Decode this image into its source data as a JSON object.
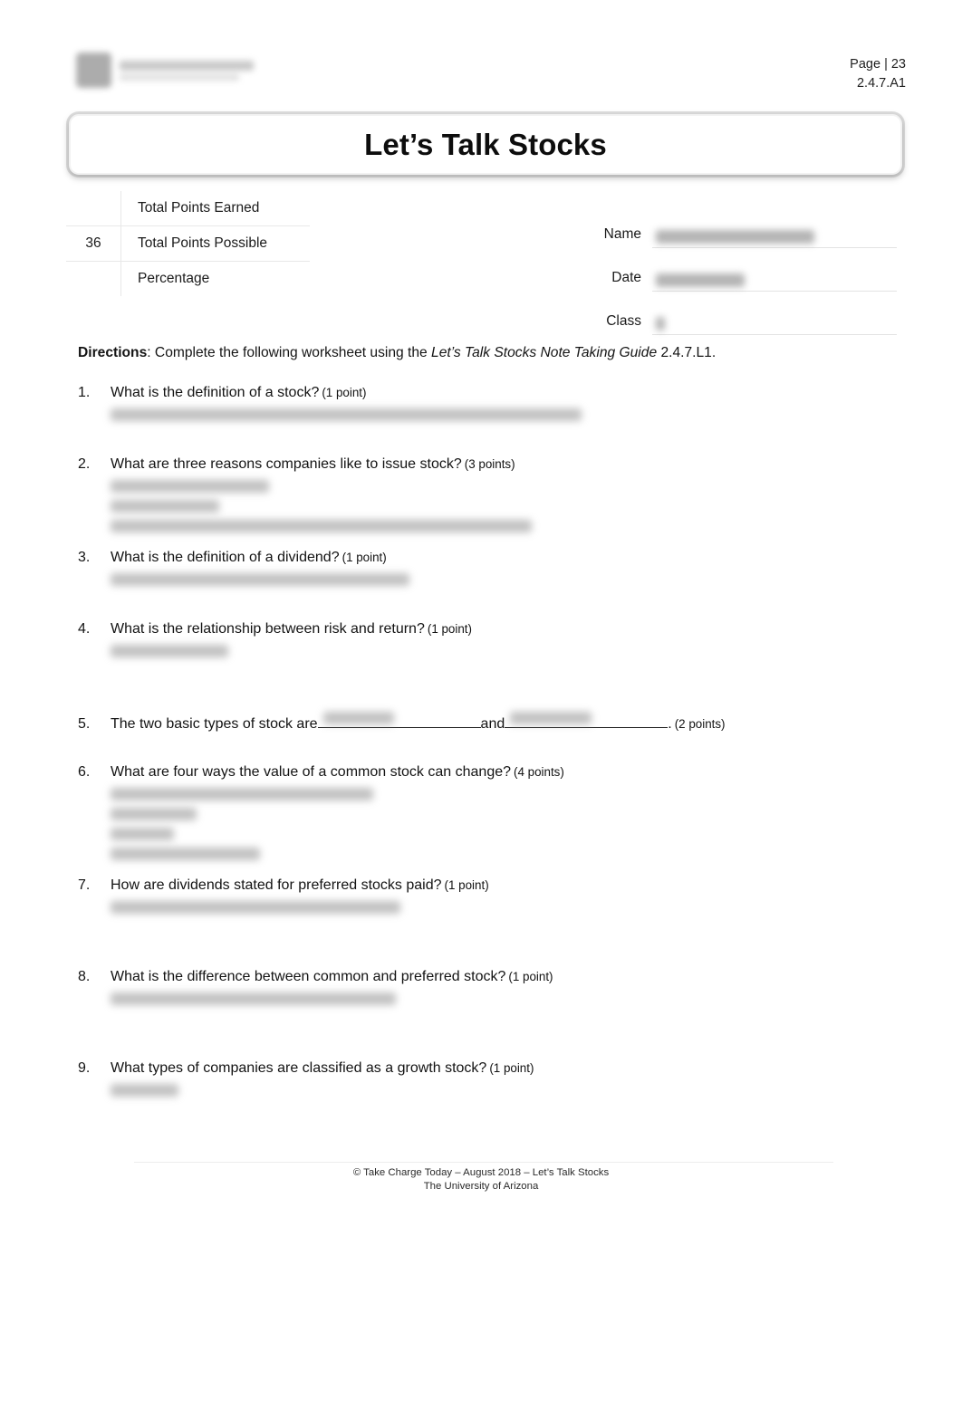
{
  "header": {
    "logo_alt": "take-charge-today-logo",
    "page_number": "Page | 23",
    "doc_code": "2.4.7.A1"
  },
  "title": "Let’s Talk Stocks",
  "points_table": {
    "rows": [
      {
        "value": "",
        "label": "Total Points Earned"
      },
      {
        "value": "36",
        "label": "Total Points Possible"
      },
      {
        "value": "",
        "label": "Percentage"
      }
    ]
  },
  "id_fields": [
    {
      "label": "Name",
      "value": "",
      "redacted": true,
      "redact_width": 175
    },
    {
      "label": "Date",
      "value": "",
      "redacted": true,
      "redact_width": 98
    },
    {
      "label": "Class",
      "value": "",
      "redacted": true,
      "redact_width": 10
    }
  ],
  "directions": {
    "bold_label": "Directions",
    "text_before": ": Complete the following worksheet using the ",
    "italic_title": "Let’s Talk Stocks Note Taking Guide",
    "text_after": " 2.4.7.L1."
  },
  "questions": [
    {
      "num": "1.",
      "text": "What is the definition of a stock?",
      "points": "(1 point)",
      "answer_lines": [
        520
      ],
      "gap": "md"
    },
    {
      "num": "2.",
      "text": "What are three reasons companies like to issue stock?",
      "points": "(3 points)",
      "answer_lines": [
        175,
        120,
        465
      ],
      "gap": "sm"
    },
    {
      "num": "3.",
      "text": "What is the definition of a dividend?",
      "points": "(1 point)",
      "answer_lines": [
        330
      ],
      "gap": "md"
    },
    {
      "num": "4.",
      "text": "What is the relationship between risk and return?",
      "points": "(1 point)",
      "answer_lines": [
        130
      ],
      "gap": "lg"
    },
    {
      "num": "6.",
      "text": "What are four ways the value of a common stock can change?",
      "points": "(4 points)",
      "answer_lines": [
        290,
        95,
        70,
        165
      ],
      "gap": "sm"
    },
    {
      "num": "7.",
      "text": "How are dividends stated for preferred stocks paid?",
      "points": "(1 point)",
      "answer_lines": [
        320
      ],
      "gap": "lg"
    },
    {
      "num": "8.",
      "text": "What is the difference between common and preferred stock?",
      "points": "(1 point)",
      "answer_lines": [
        315
      ],
      "gap": "lg"
    },
    {
      "num": "9.",
      "text": "What types of companies are classified as a growth stock?",
      "points": "(1 point)",
      "answer_lines": [
        75
      ],
      "gap": "sm"
    }
  ],
  "fill_question": {
    "num": "5.",
    "text_before": "The two basic types of stock are",
    "blank_1_width": 180,
    "text_middle": " and ",
    "blank_2_width": 180,
    "text_after": ". ",
    "points": "(2 points)",
    "blank_1_redact_width": 78,
    "blank_2_redact_width": 90
  },
  "footer": {
    "line_1": "© Take Charge Today – August 2018 – Let’s Talk Stocks",
    "line_2": "The University of Arizona"
  }
}
